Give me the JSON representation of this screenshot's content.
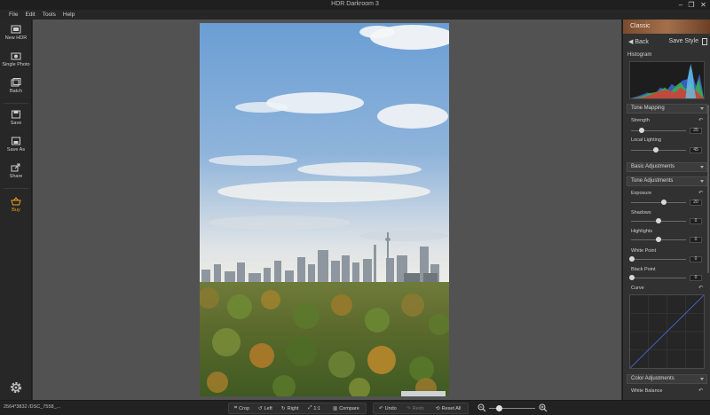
{
  "window": {
    "title": "HDR Darkroom 3",
    "minimize": "–",
    "maximize": "❐",
    "close": "✕"
  },
  "menu": [
    "File",
    "Edit",
    "Tools",
    "Help"
  ],
  "sidebar": {
    "items": [
      {
        "label": "New HDR",
        "icon": "new-hdr-icon"
      },
      {
        "label": "Single Photo",
        "icon": "single-photo-icon"
      },
      {
        "label": "Batch",
        "icon": "batch-icon"
      },
      {
        "label": "Save",
        "icon": "save-icon"
      },
      {
        "label": "Save As",
        "icon": "save-as-icon"
      },
      {
        "label": "Share",
        "icon": "share-icon"
      },
      {
        "label": "Buy",
        "icon": "basket-icon"
      }
    ],
    "settings_icon": "gear-icon"
  },
  "right_panel": {
    "style_name": "Classic",
    "back_label": "◀ Back",
    "save_style_label": "Save Style",
    "histogram_label": "Histogram",
    "tone_mapping": {
      "header": "Tone Mapping",
      "strength": {
        "label": "Strength",
        "value": "25",
        "fraction": 0.2
      },
      "local_lighting": {
        "label": "Local Lighting",
        "value": "45",
        "fraction": 0.45
      }
    },
    "basic_adjustments": "Basic Adjustments",
    "tone_adjustments": {
      "header": "Tone Adjustments",
      "exposure": {
        "label": "Exposure",
        "value": "20",
        "fraction": 0.6
      },
      "shadows": {
        "label": "Shadows",
        "value": "0",
        "fraction": 0.5
      },
      "highlights": {
        "label": "Highlights",
        "value": "0",
        "fraction": 0.5
      },
      "white_point": {
        "label": "White Point",
        "value": "0",
        "fraction": 0.02
      },
      "black_point": {
        "label": "Black Point",
        "value": "0",
        "fraction": 0.02
      },
      "curve_label": "Curve"
    },
    "color_adjustments": "Color Adjustments",
    "white_balance_label": "White Balance"
  },
  "bottom": {
    "file_info": "2564*3832 /DSC_7558_...",
    "crop": "Crop",
    "left": "Left",
    "right": "Right",
    "one_to_one": "1:1",
    "compare": "Compare",
    "undo": "Undo",
    "redo": "Redo",
    "reset_all": "Reset All"
  }
}
